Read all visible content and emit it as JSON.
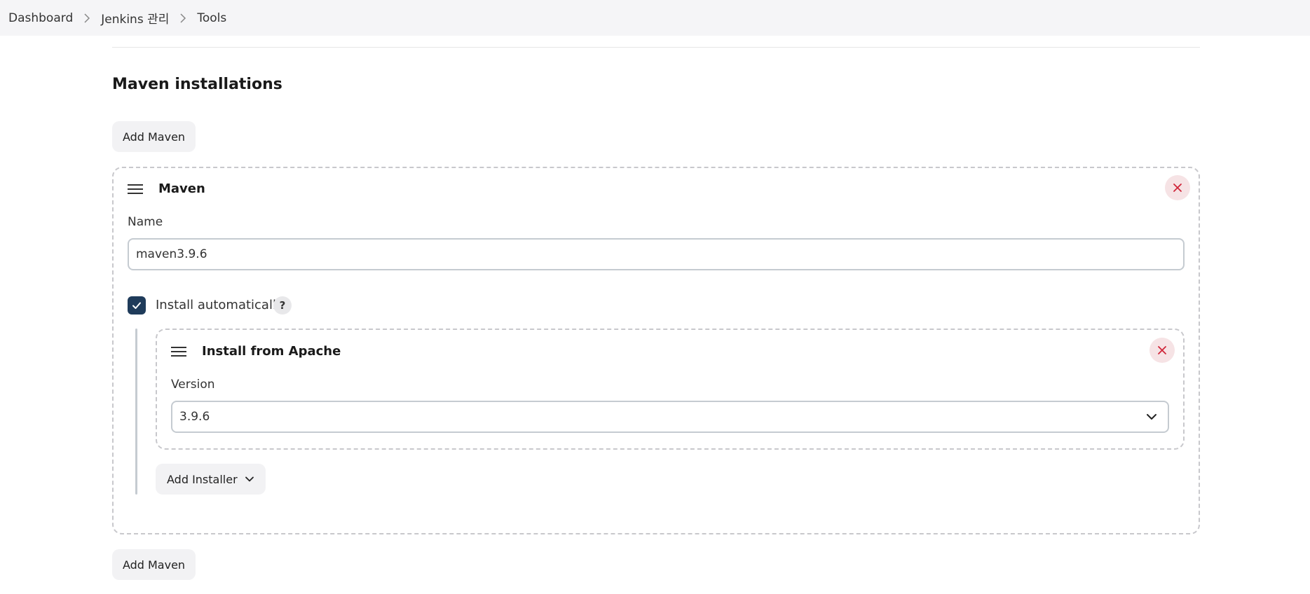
{
  "breadcrumb": {
    "items": [
      "Dashboard",
      "Jenkins 관리",
      "Tools"
    ]
  },
  "section": {
    "title": "Maven installations",
    "add_button_label": "Add Maven",
    "add_button_bottom_label": "Add Maven"
  },
  "installation": {
    "title": "Maven",
    "name_label": "Name",
    "name_value": "maven3.9.6",
    "install_auto_label": "Install automatically",
    "install_auto_checked": true,
    "help_label": "?",
    "installer": {
      "title": "Install from Apache",
      "version_label": "Version",
      "version_value": "3.9.6"
    },
    "add_installer_label": "Add Installer"
  },
  "icons": {
    "drag": "drag-handle-icon",
    "close": "close-icon",
    "chevron_down": "chevron-down-icon",
    "chevron_right": "chevron-right-icon",
    "check": "check-icon"
  },
  "colors": {
    "checkbox_bg": "#1f3b5a",
    "close_bg": "#f6e3e5",
    "close_icon": "#d0263a",
    "topbar_bg": "#f5f5f7"
  }
}
